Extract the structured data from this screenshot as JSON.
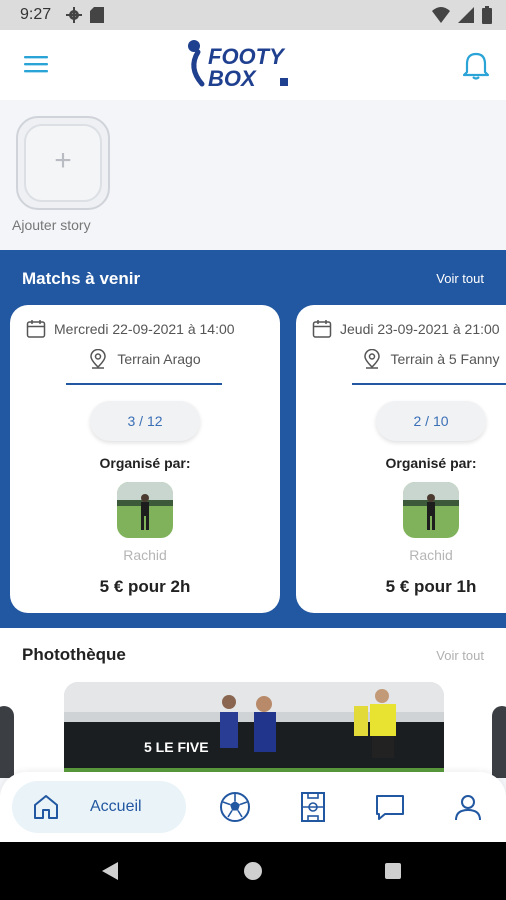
{
  "status_bar": {
    "time": "9:27"
  },
  "header": {
    "logo_text_top": "FOOTY",
    "logo_text_bottom": "BOX"
  },
  "stories": {
    "add_label": "Ajouter story",
    "add_symbol": "+"
  },
  "matches_section": {
    "title": "Matchs à venir",
    "see_all": "Voir tout",
    "cards": [
      {
        "date": "Mercredi 22-09-2021 à 14:00",
        "field": "Terrain Arago",
        "players": "3 / 12",
        "organized_by_label": "Organisé par:",
        "organizer": "Rachid",
        "price": "5 € pour 2h"
      },
      {
        "date": "Jeudi 23-09-2021 à 21:00",
        "field": "Terrain à 5 Fanny",
        "players": "2 / 10",
        "organized_by_label": "Organisé par:",
        "organizer": "Rachid",
        "price": "5 € pour 1h"
      }
    ]
  },
  "photos_section": {
    "title": "Photothèque",
    "see_all": "Voir tout",
    "photo_caption": "5 LE FIVE"
  },
  "bottom_nav": {
    "home_label": "Accueil"
  },
  "colors": {
    "brand_blue": "#2257a1",
    "accent_cyan": "#2aa3d6"
  }
}
